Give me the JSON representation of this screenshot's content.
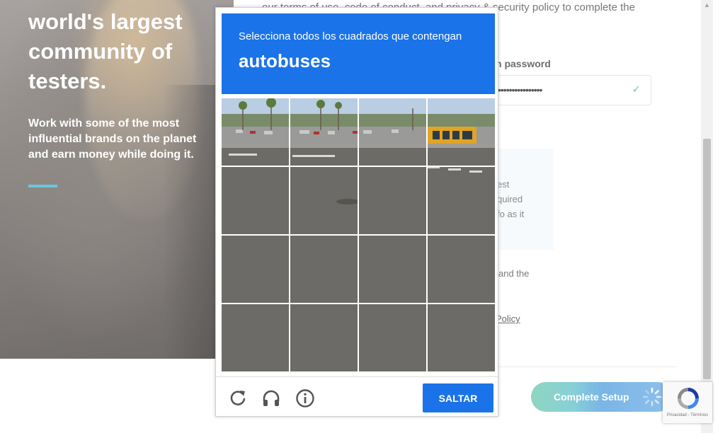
{
  "hero": {
    "title": "world's largest community of testers.",
    "subtitle": "Work with some of the most influential brands on the planet and earn money while doing it."
  },
  "form": {
    "top_text": "our terms of use, code of conduct, and privacy & security policy to complete the",
    "password_label_fragment": "n password",
    "password_mask": "••••••••••••••••",
    "info_lines": [
      "est",
      "quired",
      "fo as it"
    ],
    "terms_fragment": "and the",
    "policy_fragment": "Policy",
    "complete_button": "Complete Setup"
  },
  "captcha": {
    "instruction": "Selecciona todos los cuadrados que contengan",
    "target": "autobuses",
    "skip_button": "SALTAR",
    "footer_icons": [
      "refresh-icon",
      "audio-headphones-icon",
      "info-icon"
    ],
    "grid_rows": 4,
    "grid_cols": 4
  },
  "recaptcha_badge": {
    "terms": "Privacidad - Términos"
  },
  "colors": {
    "captcha_blue": "#1a73e8",
    "hero_accent": "#6cc7dc",
    "button_gradient_start": "#8fd6c0",
    "button_gradient_end": "#7ab5e6"
  }
}
